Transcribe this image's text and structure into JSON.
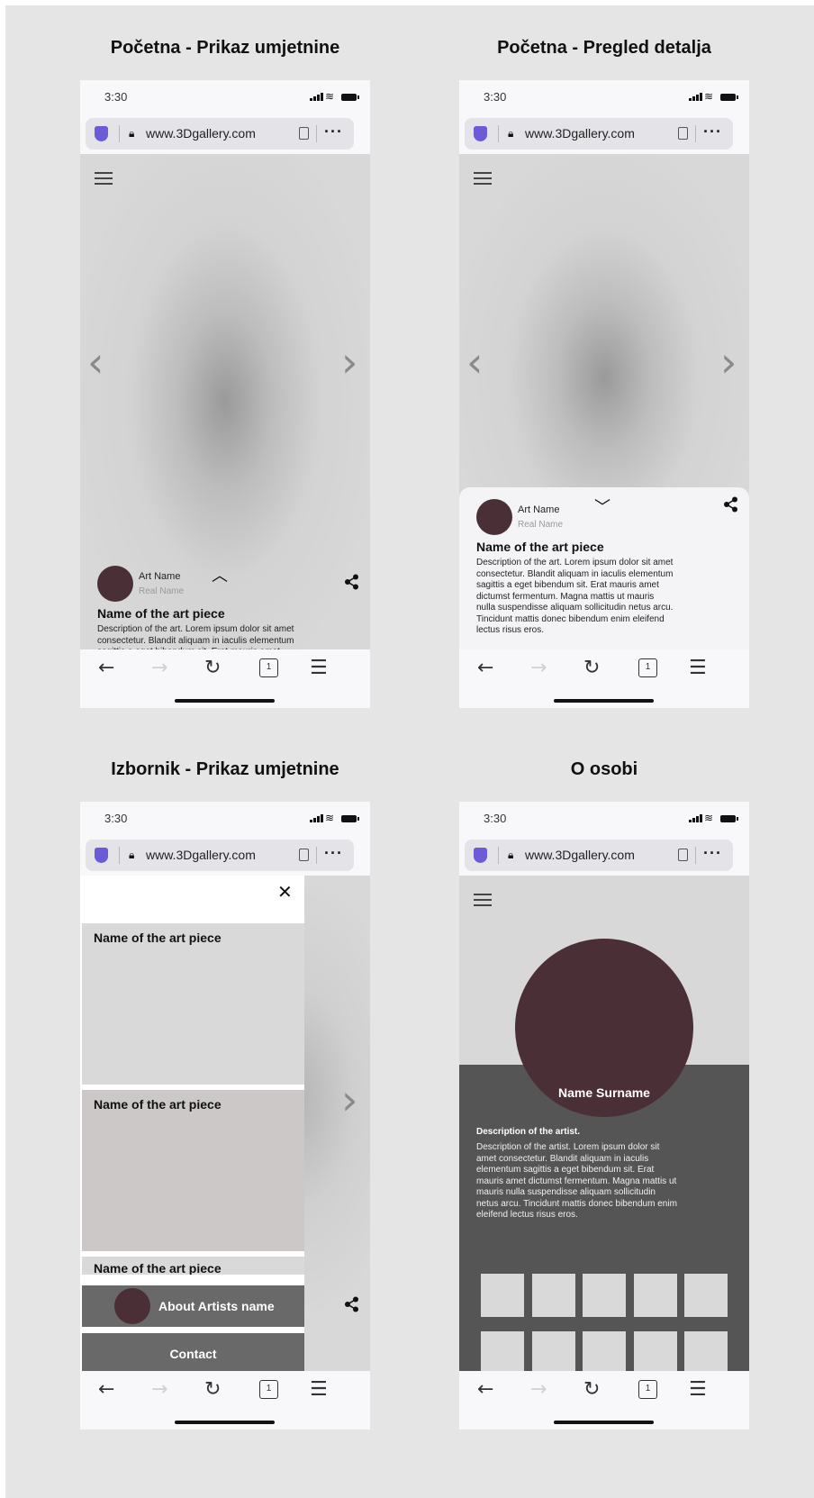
{
  "frames": [
    {
      "title": "Početna - Prikaz umjetnine"
    },
    {
      "title": "Početna - Pregled detalja"
    },
    {
      "title": "Izbornik - Prikaz umjetnine"
    },
    {
      "title": "O osobi"
    }
  ],
  "status": {
    "time": "3:30"
  },
  "browser": {
    "url": "www.3Dgallery.com",
    "more": "···",
    "tab_count": "1"
  },
  "icons": {
    "prev": "‹",
    "next": "›",
    "chevron_up": "⌃",
    "chevron_down": "⌄",
    "close": "✕",
    "back": "←",
    "forward": "→",
    "reload": "↻",
    "menu": "☰",
    "lock": "🔒",
    "wifi": "📶"
  },
  "art": {
    "art_name": "Art Name",
    "real_name": "Real Name",
    "piece_name": "Name of the art piece",
    "description": "Description of the art. Lorem ipsum dolor sit amet consectetur. Blandit aliquam in iaculis elementum sagittis a eget bibendum sit. Erat mauris amet dictumst fermentum. Magna mattis ut mauris nulla suspendisse aliquam sollicitudin netus arcu. Tincidunt mattis donec bibendum enim eleifend lectus risus eros."
  },
  "menu": {
    "cards": [
      "Name of the art piece",
      "Name of the art piece",
      "Name of the art piece"
    ],
    "about_label": "About Artists name",
    "contact_label": "Contact"
  },
  "about": {
    "name": "Name Surname",
    "heading": "Description of the artist.",
    "description": "Description of the artist. Lorem ipsum dolor sit amet consectetur. Blandit aliquam in iaculis elementum sagittis a eget bibendum sit. Erat mauris amet dictumst fermentum. Magna mattis ut mauris nulla suspendisse aliquam sollicitudin netus arcu. Tincidunt mattis donec bibendum enim eleifend lectus risus eros."
  },
  "colors": {
    "canvas": "#e5e5e5",
    "avatar": "#4a2f37",
    "accent_shield": "#6b5bd6",
    "menu_button": "#696969",
    "about_dark": "#555555"
  }
}
